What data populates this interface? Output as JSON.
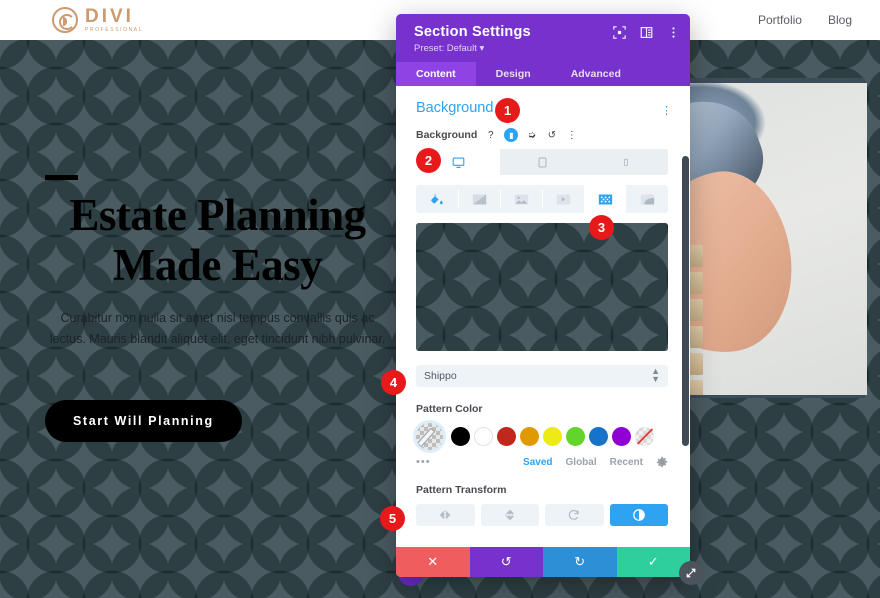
{
  "site": {
    "logo": {
      "name": "DIVI",
      "tagline": "PROFESSIONAL"
    },
    "nav": [
      {
        "label": "Portfolio"
      },
      {
        "label": "Blog"
      }
    ],
    "hero": {
      "title": "Estate Planning Made Easy",
      "subtitle": "Curabitur non nulla sit amet nisl tempus convallis quis ac lectus. Mauris blandit aliquet elit, eget tincidunt nibh pulvinar.",
      "cta_label": "Start Will Planning",
      "background_color": "#76848a",
      "pattern_color": "#9fb0b4"
    }
  },
  "modal": {
    "title": "Section Settings",
    "preset": "Preset: Default",
    "header_icons": [
      {
        "name": "focus-icon"
      },
      {
        "name": "layout-columns-icon"
      },
      {
        "name": "kebab-menu-icon"
      }
    ],
    "tabs": [
      {
        "label": "Content",
        "active": true
      },
      {
        "label": "Design",
        "active": false
      },
      {
        "label": "Advanced",
        "active": false
      }
    ],
    "section": {
      "title": "Background",
      "kebab": "⋮"
    },
    "background_field": {
      "label": "Background",
      "help": "?",
      "responsive_badge": "▮",
      "hover_icon": "⬈",
      "reset_icon": "↺",
      "kebab_icon": "⋮"
    },
    "device_tabs": [
      {
        "name": "desktop",
        "active": true
      },
      {
        "name": "tablet",
        "active": false
      },
      {
        "name": "phone",
        "active": false
      }
    ],
    "bg_types": [
      {
        "name": "color",
        "active": false
      },
      {
        "name": "gradient",
        "active": false
      },
      {
        "name": "image",
        "active": false
      },
      {
        "name": "video",
        "active": false
      },
      {
        "name": "pattern",
        "active": true
      },
      {
        "name": "mask",
        "active": false
      }
    ],
    "pattern": {
      "selected": "Shippo",
      "color_label": "Pattern Color",
      "transform_label": "Pattern Transform"
    },
    "swatches": [
      {
        "name": "current",
        "color": "transparent"
      },
      {
        "name": "black",
        "color": "#000000"
      },
      {
        "name": "white",
        "color": "#ffffff"
      },
      {
        "name": "red",
        "color": "#c0281c"
      },
      {
        "name": "orange",
        "color": "#e09900"
      },
      {
        "name": "yellow",
        "color": "#edea15"
      },
      {
        "name": "green",
        "color": "#62d42c"
      },
      {
        "name": "blue",
        "color": "#1673c8"
      },
      {
        "name": "purple",
        "color": "#9000d4"
      },
      {
        "name": "none",
        "color": "transparent"
      }
    ],
    "swatch_tabs": [
      {
        "label": "Saved",
        "active": true
      },
      {
        "label": "Global",
        "active": false
      },
      {
        "label": "Recent",
        "active": false
      }
    ],
    "swatch_settings_icon": "gear-icon",
    "swatch_more": "•••",
    "transform_buttons": [
      {
        "name": "flip-horizontal",
        "active": false
      },
      {
        "name": "flip-vertical",
        "active": false
      },
      {
        "name": "rotate",
        "active": false
      },
      {
        "name": "invert",
        "active": true
      }
    ],
    "footer": [
      {
        "name": "cancel",
        "glyph": "✕",
        "color": "#f05d5e"
      },
      {
        "name": "undo",
        "glyph": "↺",
        "color": "#7731cd"
      },
      {
        "name": "redo",
        "glyph": "↻",
        "color": "#2d8fd5"
      },
      {
        "name": "save",
        "glyph": "✓",
        "color": "#2ecf9d"
      }
    ]
  },
  "callouts": [
    {
      "id": 1,
      "label": "1"
    },
    {
      "id": 2,
      "label": "2"
    },
    {
      "id": 3,
      "label": "3"
    },
    {
      "id": 4,
      "label": "4"
    },
    {
      "id": 5,
      "label": "5"
    }
  ]
}
